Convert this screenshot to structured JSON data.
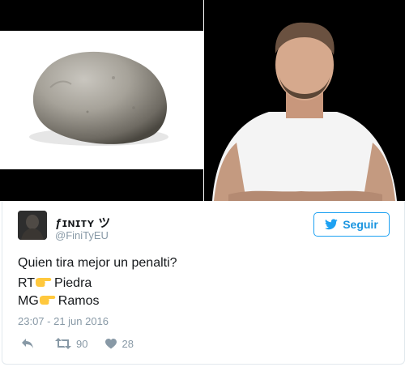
{
  "tweet": {
    "display_name": "ƒɪɴɪᴛʏ ツ",
    "handle": "@FiniTyEU",
    "follow_label": "Seguir",
    "text_line1": "Quien tira mejor un penalti?",
    "line2_prefix": "RT",
    "line2_label": "Piedra",
    "line3_prefix": "MG",
    "line3_label": "Ramos",
    "timestamp": "23:07 - 21 jun 2016",
    "retweet_count": "90",
    "like_count": "28"
  },
  "icons": {
    "pointer": "backhand-index-pointing-right-icon",
    "follow": "twitter-bird-icon",
    "reply": "reply-icon",
    "retweet": "retweet-icon",
    "like": "heart-icon"
  },
  "colors": {
    "accent": "#1da1f2",
    "text": "#14171a",
    "muted": "#8899a6",
    "pointer": "#ffc83d"
  }
}
